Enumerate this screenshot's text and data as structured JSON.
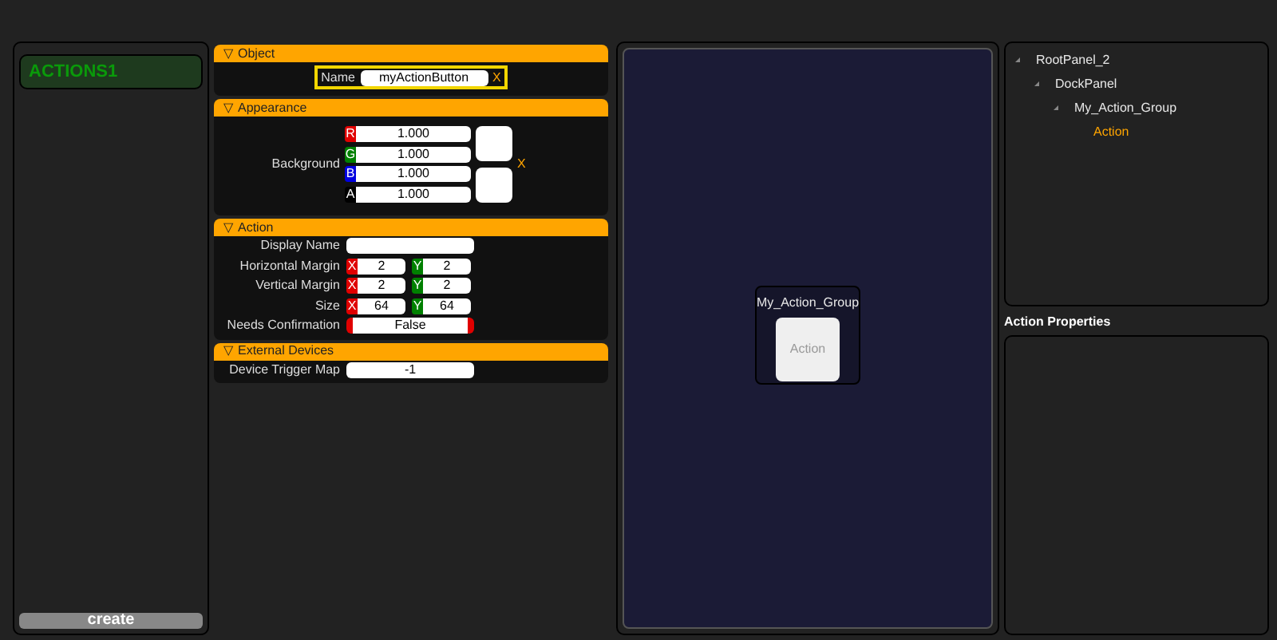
{
  "left_panel": {
    "title": "ACTIONS1",
    "create_button": "create"
  },
  "sections": [
    {
      "toggle": "▽",
      "title": "Object",
      "rows": [
        {
          "kind": "name",
          "label": "Name",
          "value": "myActionButton",
          "clear": "X"
        }
      ]
    },
    {
      "toggle": "▽",
      "title": "Appearance",
      "rows": [
        {
          "kind": "color",
          "label": "Background",
          "clear": "X",
          "channels": [
            {
              "tag": "R",
              "value": "1.000",
              "color": "#e00000"
            },
            {
              "tag": "G",
              "value": "1.000",
              "color": "#008000"
            },
            {
              "tag": "B",
              "value": "1.000",
              "color": "#0000e0"
            },
            {
              "tag": "A",
              "value": "1.000",
              "color": "#000000"
            }
          ]
        }
      ]
    },
    {
      "toggle": "▽",
      "title": "Action",
      "rows": [
        {
          "kind": "text",
          "label": "Display Name",
          "value": ""
        },
        {
          "kind": "xy",
          "label": "Horizontal Margin",
          "x": {
            "tag": "X",
            "value": "2",
            "color": "#e00000"
          },
          "y": {
            "tag": "Y",
            "value": "2",
            "color": "#008000"
          }
        },
        {
          "kind": "xy",
          "label": "Vertical Margin",
          "x": {
            "tag": "X",
            "value": "2",
            "color": "#e00000"
          },
          "y": {
            "tag": "Y",
            "value": "2",
            "color": "#008000"
          }
        },
        {
          "kind": "xy",
          "label": "Size",
          "x": {
            "tag": "X",
            "value": "64",
            "color": "#e00000"
          },
          "y": {
            "tag": "Y",
            "value": "64",
            "color": "#008000"
          }
        },
        {
          "kind": "toggle",
          "label": "Needs Confirmation",
          "value": "False",
          "on": false
        }
      ]
    },
    {
      "toggle": "▽",
      "title": "External Devices",
      "rows": [
        {
          "kind": "text",
          "label": "Device Trigger Map",
          "value": "-1"
        }
      ]
    }
  ],
  "canvas": {
    "group": "My_Action_Group",
    "button": "Action"
  },
  "tree": [
    {
      "label": "RootPanel_2",
      "selected": false,
      "children": [
        {
          "label": "DockPanel",
          "selected": false,
          "children": [
            {
              "label": "My_Action_Group",
              "selected": false,
              "children": [
                {
                  "label": "Action",
                  "selected": true
                }
              ]
            }
          ]
        }
      ]
    }
  ],
  "properties_title": "Action Properties"
}
